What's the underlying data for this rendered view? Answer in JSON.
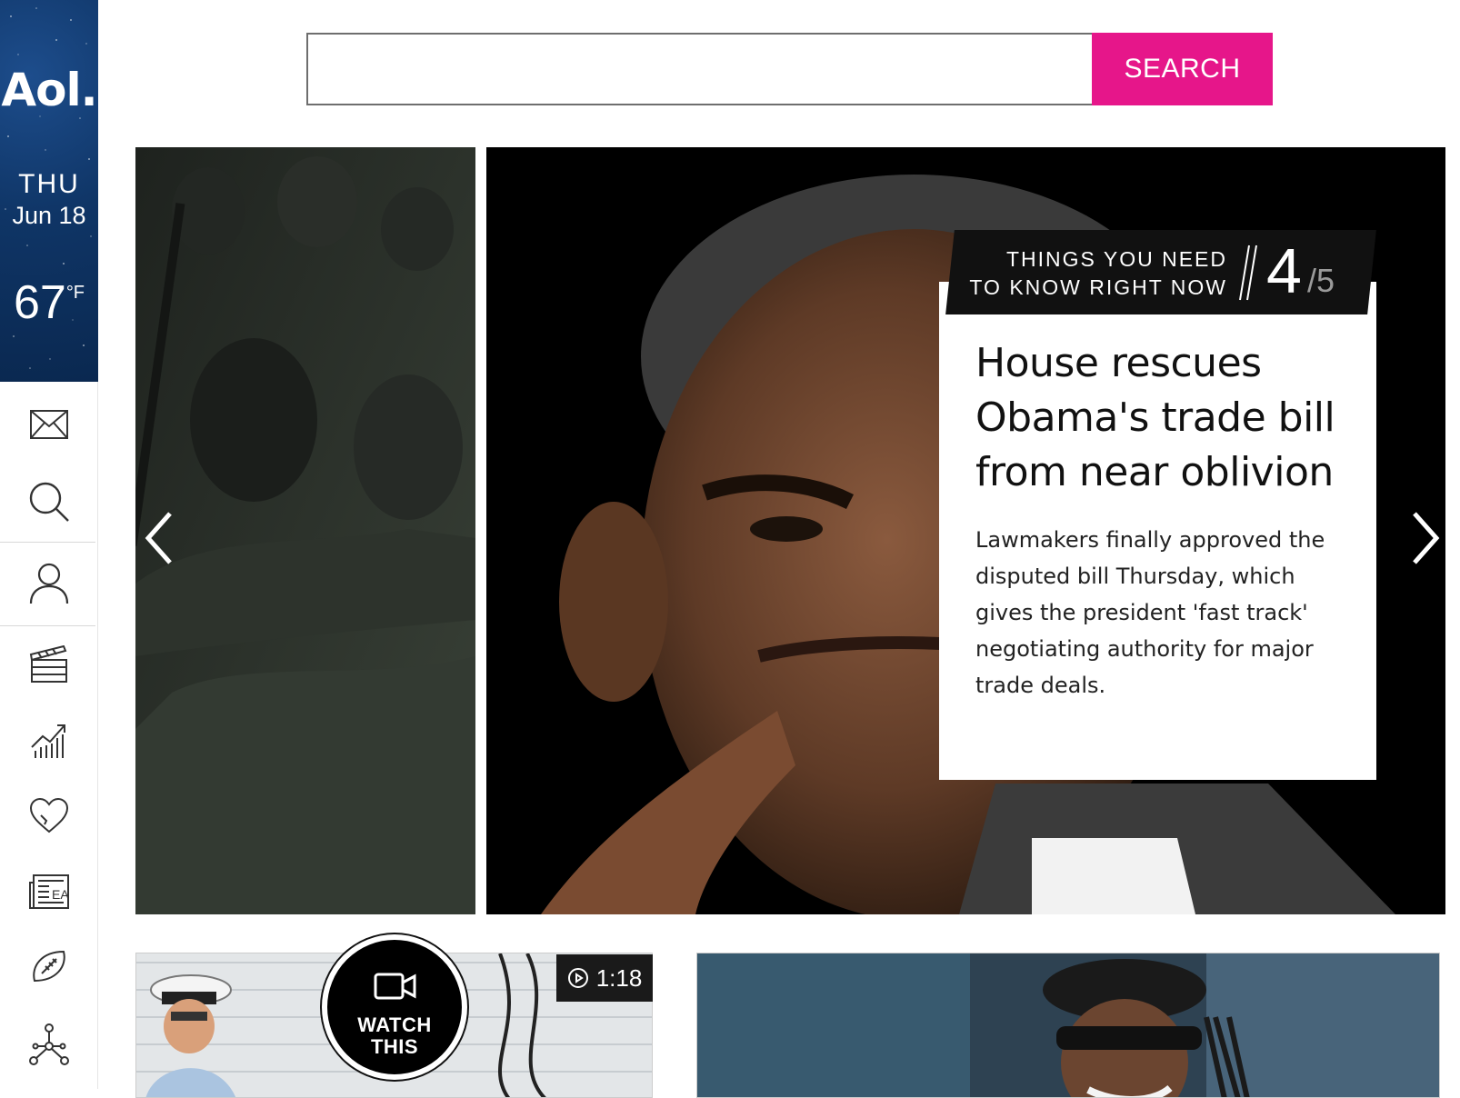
{
  "sidebar": {
    "logo": "Aol.",
    "day": "THU",
    "date": "Jun 18",
    "temp": "67",
    "temp_unit": "°F",
    "nav_icons": [
      "mail-icon",
      "search-icon",
      "user-icon",
      "entertainment-icon",
      "finance-icon",
      "lifestyle-icon",
      "news-icon",
      "sports-icon",
      "more-icon"
    ]
  },
  "search": {
    "placeholder": "",
    "button_label": "SEARCH"
  },
  "carousel": {
    "tag_line1": "THINGS YOU NEED",
    "tag_line2": "TO KNOW RIGHT NOW",
    "current": "4",
    "total": "/5",
    "headline": "House rescues Obama's trade bill from near oblivion",
    "description": "Lawmakers finally approved the disputed bill Thursday, which gives the president 'fast track' negotiating authority for major trade deals."
  },
  "video": {
    "watch_line1": "WATCH",
    "watch_line2": "THIS",
    "duration": "1:18"
  },
  "colors": {
    "accent": "#e6168a",
    "brand_blue": "#0f3566"
  }
}
